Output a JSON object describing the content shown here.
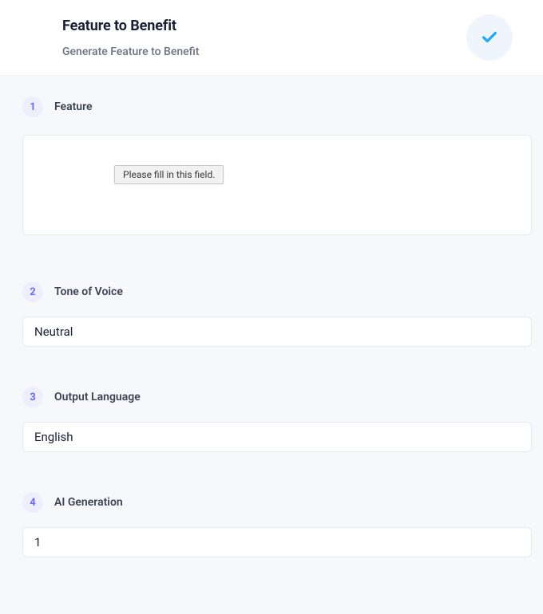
{
  "header": {
    "title": "Feature to Benefit",
    "subtitle": "Generate Feature to Benefit",
    "icon": "check-icon"
  },
  "fields": {
    "feature": {
      "number": "1",
      "label": "Feature",
      "value": "",
      "validation_tooltip": "Please fill in this field."
    },
    "tone": {
      "number": "2",
      "label": "Tone of Voice",
      "value": "Neutral"
    },
    "language": {
      "number": "3",
      "label": "Output Language",
      "value": "English"
    },
    "ai_generation": {
      "number": "4",
      "label": "AI Generation",
      "value": "1"
    }
  }
}
